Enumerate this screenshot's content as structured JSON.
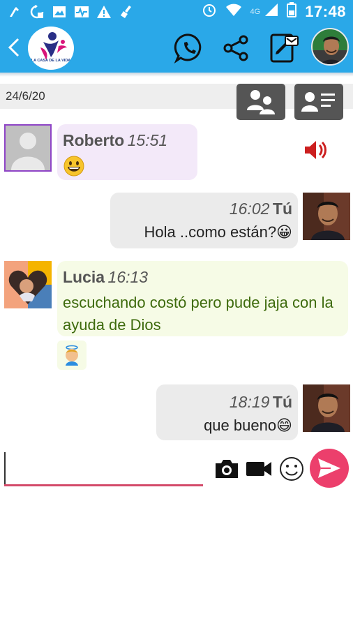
{
  "status_bar": {
    "time": "17:48",
    "network": "4G",
    "left_icons": [
      "cleaner-icon",
      "sync-icon",
      "image-icon",
      "pulse-icon",
      "warning-icon",
      "broom-icon"
    ],
    "right_icons": [
      "alarm-icon",
      "wifi-icon",
      "signal-icon",
      "battery-icon"
    ]
  },
  "app_bar": {
    "logo_text": "LA CASA DE LA VIDA",
    "actions": [
      "whatsapp-icon",
      "share-icon",
      "notes-icon"
    ],
    "colors": {
      "bar": "#2aa8e8"
    }
  },
  "chat": {
    "date": "24/6/20",
    "header_buttons": [
      "group-icon",
      "contact-card-icon"
    ],
    "messages": [
      {
        "sender": "Roberto",
        "time": "15:51",
        "text": "😀",
        "avatar": "default-avatar"
      },
      {
        "sender": "Tú",
        "time": "16:02",
        "text": "Hola ..como están?😀",
        "avatar": "user-photo"
      },
      {
        "sender": "Lucia",
        "time": "16:13",
        "text": "escuchando costó pero pude jaja con la ayuda de Dios",
        "avatar": "lucia-photo"
      },
      {
        "sender": "",
        "time": "",
        "text": "👼",
        "avatar": ""
      },
      {
        "sender": "Tú",
        "time": "18:19",
        "text": "que bueno😄",
        "avatar": "user-photo"
      }
    ]
  },
  "composer": {
    "placeholder": "",
    "tools": [
      "camera-icon",
      "video-icon",
      "emoji-icon",
      "send-icon"
    ],
    "colors": {
      "underline": "#d34a6a",
      "send": "#ec3f6c"
    }
  }
}
